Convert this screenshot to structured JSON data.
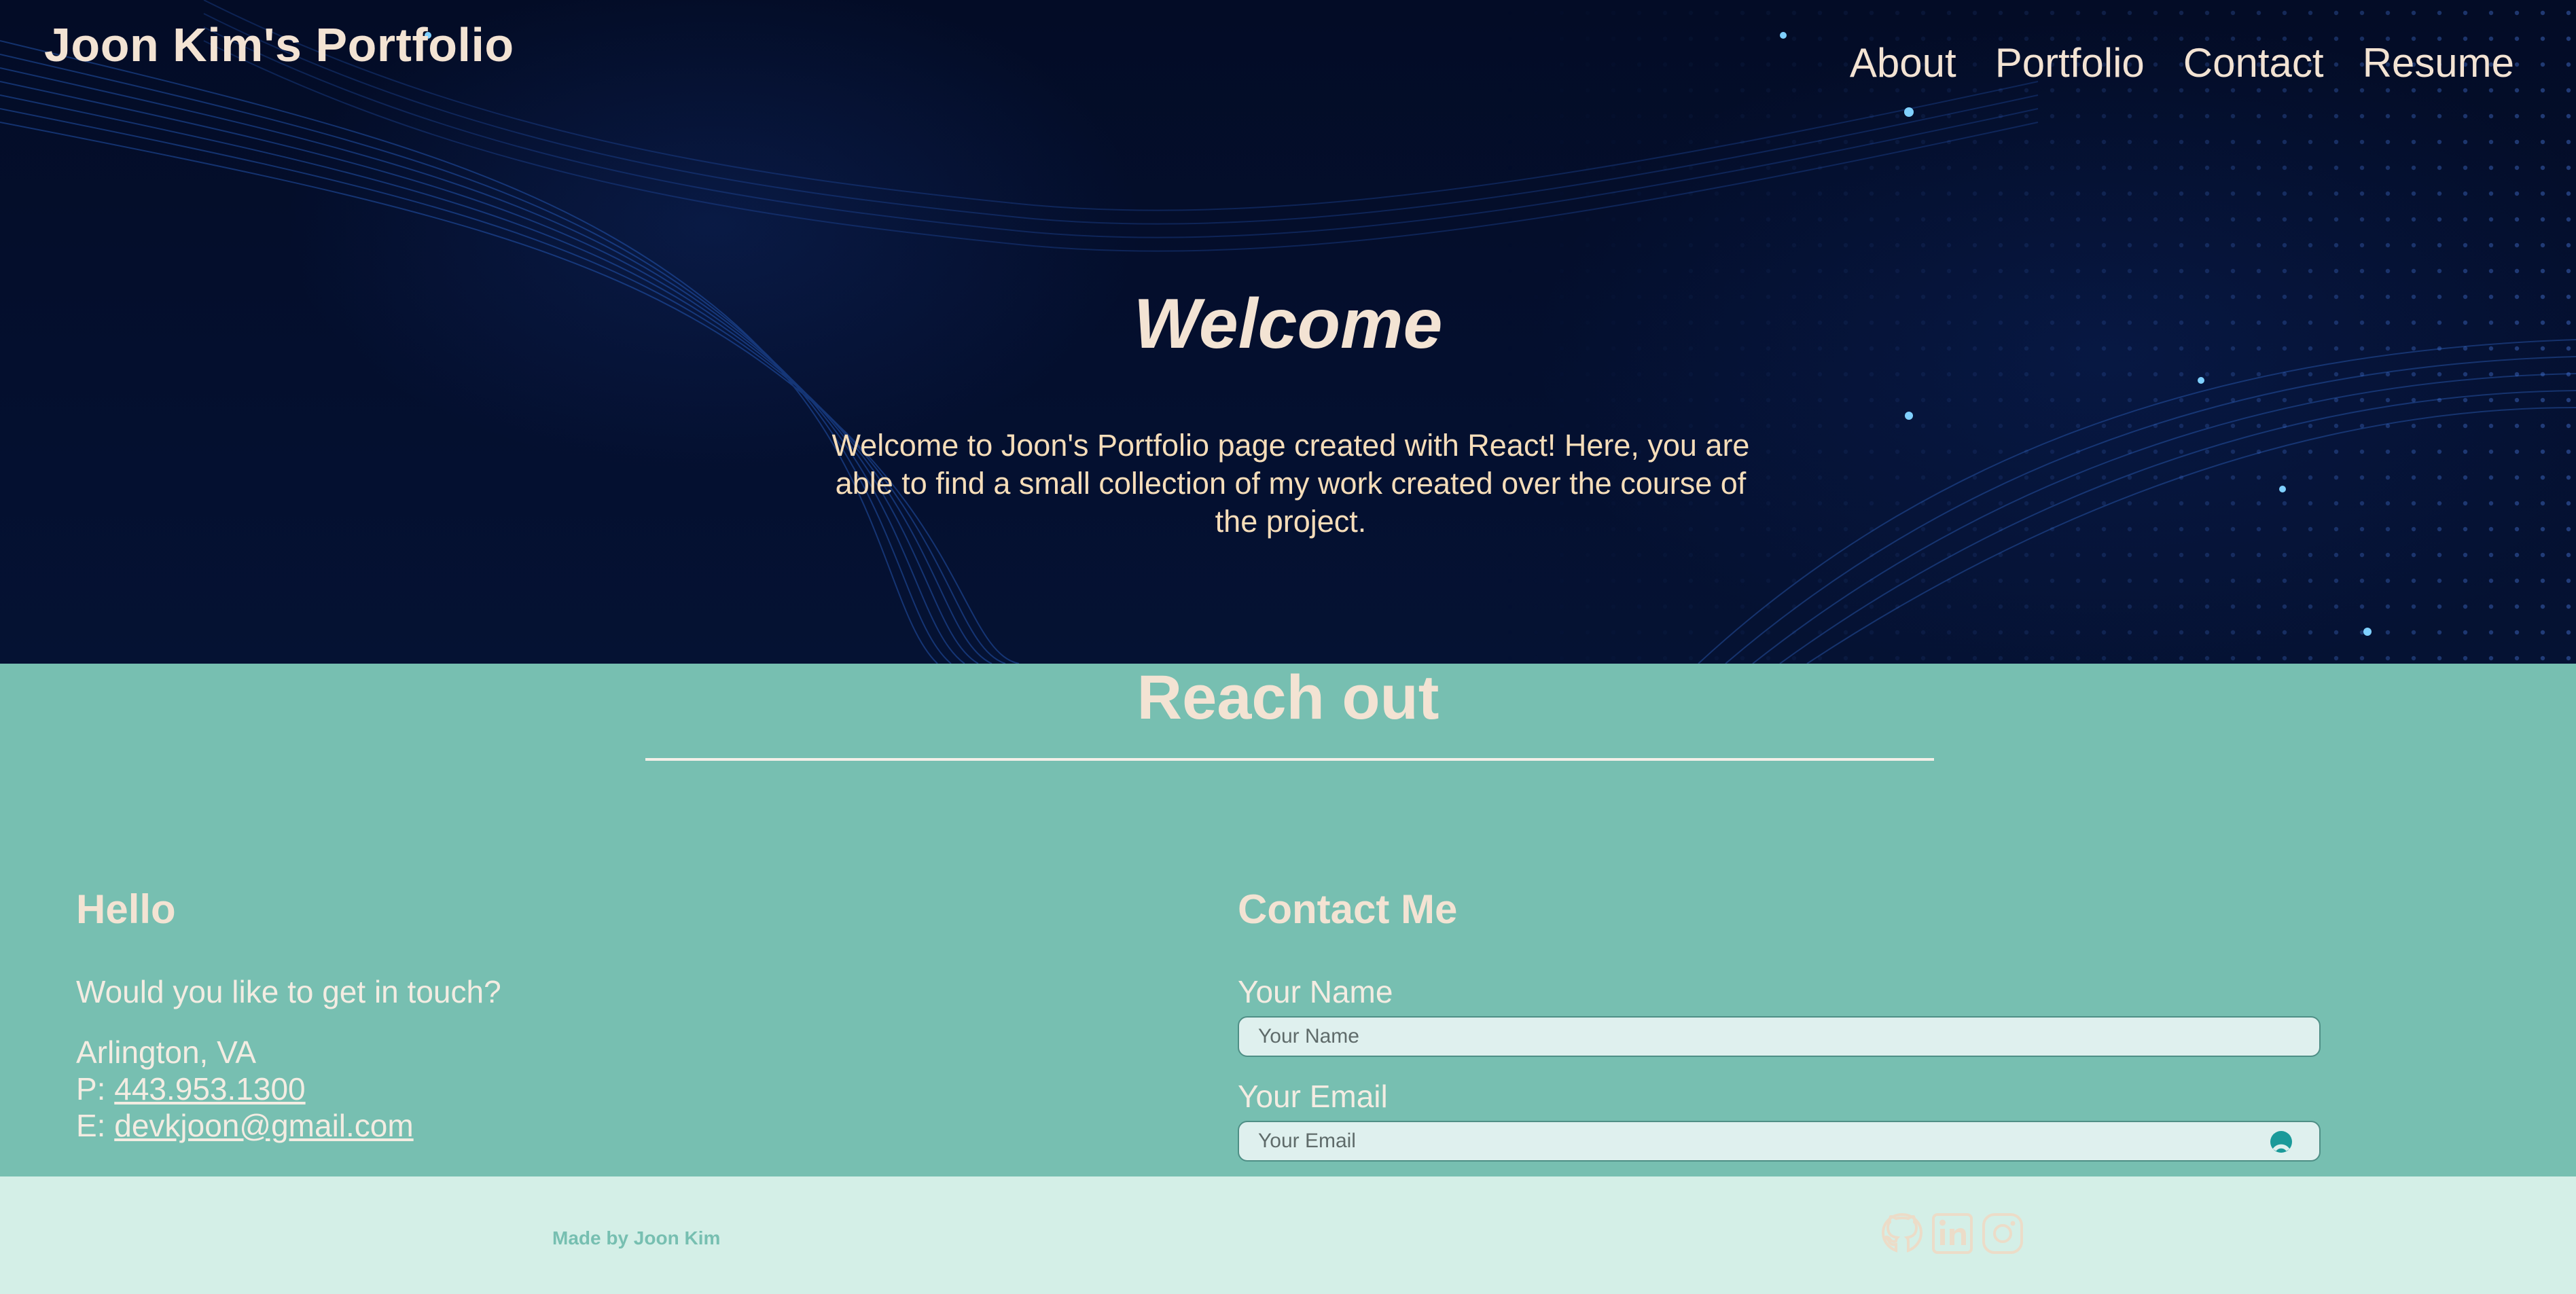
{
  "header": {
    "brand": "Joon Kim's Portfolio",
    "nav": [
      "About",
      "Portfolio",
      "Contact",
      "Resume"
    ]
  },
  "hero": {
    "title": "Welcome",
    "text": "Welcome to Joon's Portfolio page created with React! Here, you are able to find a small collection of my work created over the course of the project."
  },
  "contact": {
    "section_title": "Reach out",
    "hello": {
      "heading": "Hello",
      "prompt": "Would you like to get in touch?",
      "location": "Arlington, VA",
      "phone_prefix": "P: ",
      "phone": "443.953.1300",
      "email_prefix": "E: ",
      "email": "devkjoon@gmail.com"
    },
    "form": {
      "heading": "Contact Me",
      "name_label": "Your Name",
      "name_placeholder": "Your Name",
      "email_label": "Your Email",
      "email_placeholder": "Your Email"
    }
  },
  "footer": {
    "credit": "Made by Joon Kim",
    "socials": [
      "github-icon",
      "linkedin-icon",
      "instagram-icon"
    ]
  },
  "colors": {
    "hero_bg": "#030c26",
    "accent_teal": "#77bfb1",
    "cream_text": "#f3e3d3",
    "footer_bg": "#d4efe7"
  }
}
